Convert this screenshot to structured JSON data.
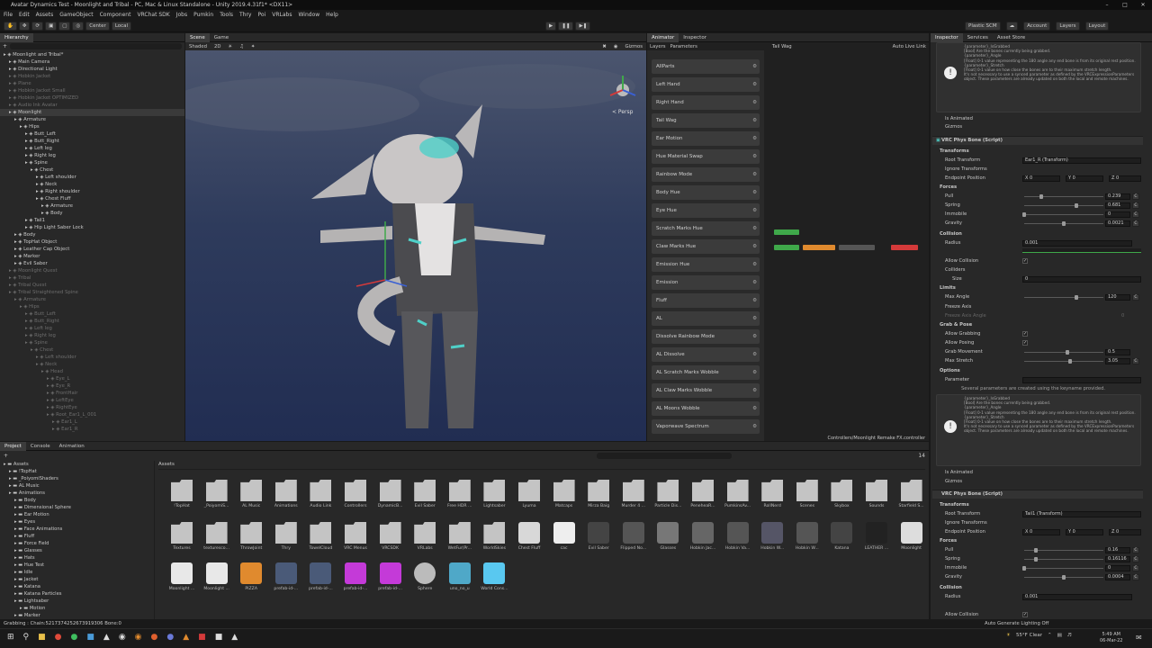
{
  "window": {
    "title": "Avatar Dynamics Test - Moonlight and Tribal - PC, Mac & Linux Standalone - Unity 2019.4.31f1* <DX11>"
  },
  "menu": [
    "File",
    "Edit",
    "Assets",
    "GameObject",
    "Component",
    "VRChat SDK",
    "Jobs",
    "Pumkin",
    "Tools",
    "Thry",
    "Poi",
    "VRLabs",
    "Window",
    "Help"
  ],
  "toolbar": {
    "center": "Center",
    "local": "Local",
    "plastic": "Plastic SCM",
    "account": "Account",
    "layers": "Layers",
    "layout": "Layout"
  },
  "hierarchy": {
    "tab": "Hierarchy",
    "rows": [
      {
        "t": "Moonlight and Tribal*",
        "d": 0,
        "dim": false
      },
      {
        "t": "Main Camera",
        "d": 1,
        "dim": false
      },
      {
        "t": "Directional Light",
        "d": 1,
        "dim": false
      },
      {
        "t": "Hobkin Jacket",
        "d": 1,
        "dim": true
      },
      {
        "t": "Plane",
        "d": 1,
        "dim": true
      },
      {
        "t": "Hobkin Jacket Small",
        "d": 1,
        "dim": true
      },
      {
        "t": "Hobkin Jacket OPTIMIZED",
        "d": 1,
        "dim": true
      },
      {
        "t": "Audio Ink Avatar",
        "d": 1,
        "dim": true
      },
      {
        "t": "Moonlight",
        "d": 1,
        "dim": false,
        "sel": true
      },
      {
        "t": "Armature",
        "d": 2,
        "dim": false
      },
      {
        "t": "Hips",
        "d": 3,
        "dim": false
      },
      {
        "t": "Butt_Left",
        "d": 4,
        "dim": false
      },
      {
        "t": "Butt_Right",
        "d": 4,
        "dim": false
      },
      {
        "t": "Left leg",
        "d": 4,
        "dim": false
      },
      {
        "t": "Right leg",
        "d": 4,
        "dim": false
      },
      {
        "t": "Spine",
        "d": 4,
        "dim": false
      },
      {
        "t": "Chest",
        "d": 5,
        "dim": false
      },
      {
        "t": "Left shoulder",
        "d": 6,
        "dim": false
      },
      {
        "t": "Neck",
        "d": 6,
        "dim": false
      },
      {
        "t": "Right shoulder",
        "d": 6,
        "dim": false
      },
      {
        "t": "Chest Fluff",
        "d": 6,
        "dim": false
      },
      {
        "t": "Armature",
        "d": 7,
        "dim": false
      },
      {
        "t": "Body",
        "d": 7,
        "dim": false
      },
      {
        "t": "Tail1",
        "d": 4,
        "dim": false
      },
      {
        "t": "Hip Light Saber Lock",
        "d": 4,
        "dim": false
      },
      {
        "t": "Body",
        "d": 2,
        "dim": false
      },
      {
        "t": "TopHat Object",
        "d": 2,
        "dim": false
      },
      {
        "t": "Leather Cap Object",
        "d": 2,
        "dim": false
      },
      {
        "t": "Marker",
        "d": 2,
        "dim": false
      },
      {
        "t": "Evil Saber",
        "d": 2,
        "dim": false
      },
      {
        "t": "Moonlight Quest",
        "d": 1,
        "dim": true
      },
      {
        "t": "Tribal",
        "d": 1,
        "dim": true
      },
      {
        "t": "Tribal Quest",
        "d": 1,
        "dim": true
      },
      {
        "t": "Tribal Straightened Spine",
        "d": 1,
        "dim": true
      },
      {
        "t": "Armature",
        "d": 2,
        "dim": true
      },
      {
        "t": "Hips",
        "d": 3,
        "dim": true
      },
      {
        "t": "Butt_Left",
        "d": 4,
        "dim": true
      },
      {
        "t": "Butt_Right",
        "d": 4,
        "dim": true
      },
      {
        "t": "Left leg",
        "d": 4,
        "dim": true
      },
      {
        "t": "Right leg",
        "d": 4,
        "dim": true
      },
      {
        "t": "Spine",
        "d": 4,
        "dim": true
      },
      {
        "t": "Chest",
        "d": 5,
        "dim": true
      },
      {
        "t": "Left shoulder",
        "d": 6,
        "dim": true
      },
      {
        "t": "Neck",
        "d": 6,
        "dim": true
      },
      {
        "t": "Head",
        "d": 7,
        "dim": true
      },
      {
        "t": "Eye_L",
        "d": 8,
        "dim": true
      },
      {
        "t": "Eye_R",
        "d": 8,
        "dim": true
      },
      {
        "t": "FrontHair",
        "d": 8,
        "dim": true
      },
      {
        "t": "LeftEye",
        "d": 8,
        "dim": true
      },
      {
        "t": "RightEye",
        "d": 8,
        "dim": true
      },
      {
        "t": "Root_Ear1_L_001",
        "d": 8,
        "dim": true
      },
      {
        "t": "Ear1_L",
        "d": 9,
        "dim": true
      },
      {
        "t": "Ear1_R",
        "d": 9,
        "dim": true
      }
    ]
  },
  "scene": {
    "tabs": [
      "Scene",
      "Game"
    ],
    "shaded": "Shaded",
    "mode2d": "2D",
    "gizmos": "Gizmos",
    "persp": "< Persp"
  },
  "animator": {
    "tabs": [
      "Animator",
      "Inspector"
    ],
    "subtabs": [
      "Layers",
      "Parameters"
    ],
    "layer_label": "Tail Wag",
    "live_link": "Auto Live Link",
    "path": "Controllers/Moonlight Remake FX.controller",
    "params": [
      "AllParts",
      "Left Hand",
      "Right Hand",
      "Tail Wag",
      "Ear Motion",
      "Hue Material Swap",
      "Rainbow Mode",
      "Body Hue",
      "Eye Hue",
      "Scratch Marks Hue",
      "Claw Marks Hue",
      "Emission Hue",
      "Emission",
      "Fluff",
      "AL",
      "Dissolve Rainbow Mode",
      "AL Dissolve",
      "AL Scratch Marks Wobble",
      "AL Claw Marks Wobble",
      "AL Moons Wobble",
      "Vaporwave Spectrum"
    ]
  },
  "inspector": {
    "tabs": [
      "Inspector",
      "Services",
      "Asset Store"
    ],
    "info_top": [
      "{parameter}_IsGrabbed",
      "[Bool] Are the bones currently being grabbed.",
      "{parameter}_Angle",
      "[Float] 0-1 value representing the 180 angle any end bone is from its original rest position.",
      "{parameter}_Stretch",
      "[Float] 0-1 value on how close the bones are to their maximum stretch length.",
      "It's not necessary to use a synced parameter as defined by the VRCExpressionParameters object. These parameters are already updated on both the local and remote machines."
    ],
    "is_animated": "Is Animated",
    "gizmos": "Gizmos",
    "comp1": {
      "title": "VRC Phys Bone (Script)",
      "transforms": "Transforms",
      "root_transform": "Root Transform",
      "root_value": "Ear1_R (Transform)",
      "ignore_transforms": "Ignore Transforms",
      "endpoint": "Endpoint Position",
      "x": "X 0",
      "y": "Y 0",
      "z": "Z 0",
      "forces": "Forces",
      "pull": "Pull",
      "pull_v": "0.239",
      "spring": "Spring",
      "spring_v": "0.681",
      "immobile": "Immobile",
      "immobile_v": "0",
      "gravity": "Gravity",
      "gravity_v": "0.0021",
      "collision": "Collision",
      "radius": "Radius",
      "radius_v": "0.001",
      "allow_collision": "Allow Collision",
      "colliders": "Colliders",
      "size": "Size",
      "size_v": "0",
      "limits": "Limits",
      "max_angle": "Max Angle",
      "max_angle_v": "120",
      "freeze_axis": "Freeze Axis",
      "freeze_axis_angle": "Freeze Axis Angle",
      "freeze_v": "0",
      "grab_pose": "Grab & Pose",
      "allow_grabbing": "Allow Grabbing",
      "allow_posing": "Allow Posing",
      "grab_movement": "Grab Movement",
      "grab_movement_v": "0.5",
      "max_stretch": "Max Stretch",
      "max_stretch_v": "3.05",
      "options": "Options",
      "parameter": "Parameter",
      "keyname_note": "Several parameters are created using the keyname provided."
    },
    "info_bottom": [
      "{parameter}_IsGrabbed",
      "[Bool] Are the bones currently being grabbed.",
      "{parameter}_Angle",
      "[Float] 0-1 value representing the 180 angle any end bone is from its original rest position.",
      "{parameter}_Stretch",
      "[Float] 0-1 value on how close the bones are to their maximum stretch length.",
      "It's not necessary to use a synced parameter as defined by the VRCExpressionParameters object. These parameters are already updated on both the local and remote machines."
    ],
    "comp2": {
      "title": "VRC Phys Bone (Script)",
      "transforms": "Transforms",
      "root_transform": "Root Transform",
      "root_value": "Tail1 (Transform)",
      "ignore_transforms": "Ignore Transforms",
      "endpoint": "Endpoint Position",
      "x": "X 0",
      "y": "Y 0",
      "z": "Z 0",
      "forces": "Forces",
      "pull": "Pull",
      "pull_v": "0.16",
      "spring": "Spring",
      "spring_v": "0.16116",
      "immobile": "Immobile",
      "immobile_v": "0",
      "gravity": "Gravity",
      "gravity_v": "0.0004",
      "collision": "Collision",
      "radius": "Radius",
      "radius_v": "0.001",
      "allow_collision": "Allow Collision"
    }
  },
  "project": {
    "tabs": [
      "Project",
      "Console",
      "Animation"
    ],
    "assets_label": "Assets",
    "count": "14",
    "tree": [
      {
        "t": "Assets",
        "d": 0
      },
      {
        "t": "!TopHat",
        "d": 1
      },
      {
        "t": "_PoiyomiShaders",
        "d": 1
      },
      {
        "t": "AL Music",
        "d": 1
      },
      {
        "t": "Animations",
        "d": 1
      },
      {
        "t": "Body",
        "d": 2
      },
      {
        "t": "Dimensional Sphere",
        "d": 2
      },
      {
        "t": "Ear Motion",
        "d": 2
      },
      {
        "t": "Eyes",
        "d": 2
      },
      {
        "t": "Face Animations",
        "d": 2
      },
      {
        "t": "Fluff",
        "d": 2
      },
      {
        "t": "Force Field",
        "d": 2
      },
      {
        "t": "Glasses",
        "d": 2
      },
      {
        "t": "Hats",
        "d": 2
      },
      {
        "t": "Hue Test",
        "d": 2
      },
      {
        "t": "Idle",
        "d": 2
      },
      {
        "t": "Jacket",
        "d": 2
      },
      {
        "t": "Katana",
        "d": 2
      },
      {
        "t": "Katana Particles",
        "d": 2
      },
      {
        "t": "Lightsaber",
        "d": 2
      },
      {
        "t": "Motion",
        "d": 3
      },
      {
        "t": "Marker",
        "d": 2
      }
    ],
    "row1": [
      "!TopHat",
      "_PoiyomiS...",
      "AL Music",
      "Animations",
      "Audio Link",
      "Controllers",
      "DynamicB...",
      "Evil Saber",
      "Free HDR ...",
      "Lightsaber",
      "Lyuma",
      "Matcaps",
      "Mirza Baig",
      "Murder 4 ...",
      "Particle Dis...",
      "PeneheaR...",
      "PumkinsAv...",
      "RollNerd",
      "Scenes",
      "Skybox",
      "Sounds",
      "Starfield S..."
    ],
    "row2": [
      "Textures",
      "texturesco...",
      "ThrowJoint",
      "Thry",
      "TowelCloud",
      "VRC Menus",
      "VRCSDK",
      "VRLabs",
      "WetFur(Pr...",
      "WorldSkies",
      "Chest Fluff",
      "cac",
      "Evil Saber",
      "Flipped No...",
      "Glasses",
      "Hobkin Jac...",
      "Hobkin Va...",
      "Hobkin W...",
      "Hobkin W...",
      "Katana",
      "LEATHER ...",
      "Moonlight"
    ],
    "row3": [
      "Moonlight ...",
      "Moonlight ...",
      "PIZZA",
      "prefab-id-...",
      "prefab-id-...",
      "prefab-id-...",
      "prefab-id-...",
      "Sphere",
      "uno_no_u",
      "World Cons..."
    ]
  },
  "status": {
    "left": "Grabbing : Chain:5217374252673919306 Bone:0",
    "right": "Auto Generate Lighting Off"
  },
  "taskbar": {
    "weather": "55°F  Clear",
    "time": "5:49 AM",
    "date": "06-Mar-22"
  },
  "colors": {
    "accent": "#4fd0c8",
    "orange": "#e08a2e",
    "green": "#3fa84a",
    "red": "#d43a3a"
  }
}
